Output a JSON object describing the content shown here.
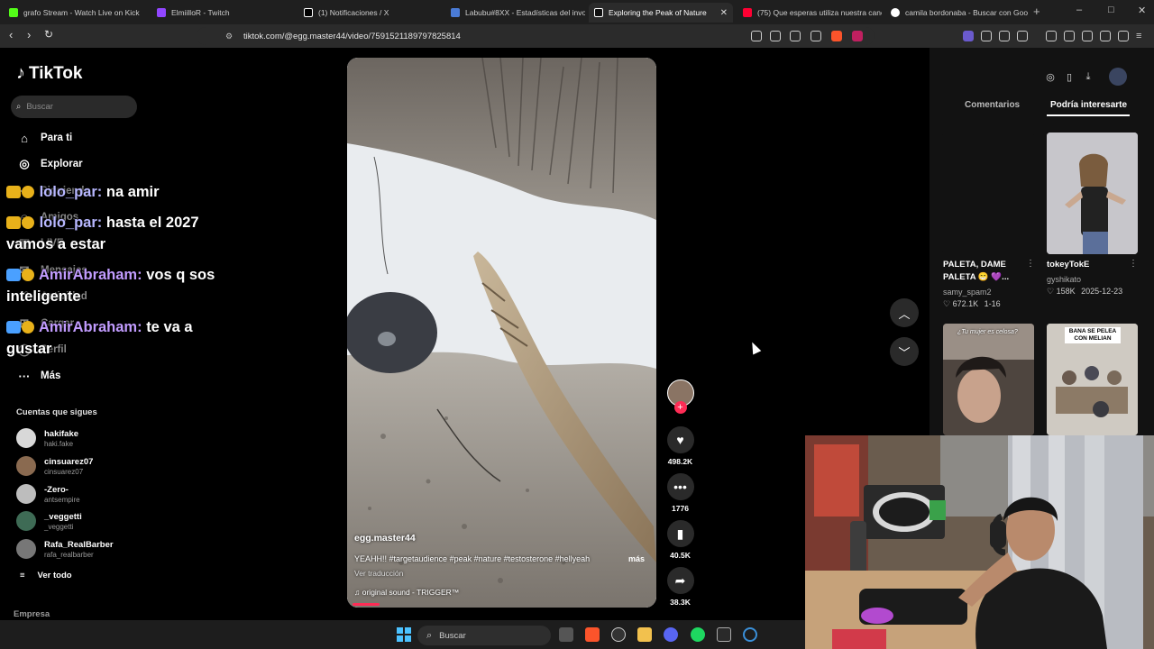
{
  "browser": {
    "tabs": [
      {
        "label": "grafo Stream - Watch Live on Kick",
        "color": "#53fc18"
      },
      {
        "label": "ElmiilloR - Twitch",
        "color": "#9146ff"
      },
      {
        "label": "(1) Notificaciones / X",
        "color": "#ffffff"
      },
      {
        "label": "Labubu#8XX - Estadísticas del invoca",
        "color": "#4a7bd6"
      },
      {
        "label": "Exploring the Peak of Nature",
        "color": "#ffffff"
      },
      {
        "label": "(75) Que esperas utiliza nuestra canc",
        "color": "#ff0033"
      },
      {
        "label": "camila bordonaba - Buscar con Goo",
        "color": "#4285f4"
      }
    ],
    "new_tab": "+",
    "url": "tiktok.com/@egg.master44/video/7591521189797825814",
    "window_controls": [
      "–",
      "□",
      "✕"
    ]
  },
  "tiktok": {
    "logo": "TikTok",
    "search_placeholder": "Buscar",
    "nav": [
      {
        "label": "Para ti",
        "icon": "home-icon"
      },
      {
        "label": "Explorar",
        "icon": "compass-icon"
      },
      {
        "label": "Siguiendo",
        "icon": "following-icon"
      },
      {
        "label": "Amigos",
        "icon": "friends-icon"
      },
      {
        "label": "LIVE",
        "icon": "live-icon"
      },
      {
        "label": "Mensajes",
        "icon": "messages-icon"
      },
      {
        "label": "Actividad",
        "icon": "activity-icon"
      },
      {
        "label": "Cargar",
        "icon": "upload-icon"
      },
      {
        "label": "Perfil",
        "icon": "profile-icon"
      },
      {
        "label": "Más",
        "icon": "more-icon"
      }
    ],
    "following_title": "Cuentas que sigues",
    "following": [
      {
        "name": "hakifake",
        "handle": "haki.fake",
        "color": "#d8d8d8"
      },
      {
        "name": "cinsuarez07",
        "handle": "cinsuarez07",
        "color": "#8a6a50"
      },
      {
        "name": "-Zero-",
        "handle": "antsempire",
        "color": "#bdbdbd"
      },
      {
        "name": "_veggetti",
        "handle": "_veggetti",
        "color": "#3e6b55"
      },
      {
        "name": "Rafa_RealBarber",
        "handle": "rafa_realbarber",
        "color": "#777777"
      }
    ],
    "see_all": "Ver todo",
    "footer": "Empresa",
    "video": {
      "author": "egg.master44",
      "caption": "YEAHH!! #targetaudience #peak #nature #testosterone #hellyeah",
      "more": "más",
      "translation": "Ver traducción",
      "sound": "original sound - TRIGGER™"
    },
    "actions": {
      "likes": "498.2K",
      "comments": "1776",
      "saves": "40.5K",
      "shares": "38.3K"
    },
    "right_panel": {
      "tab_comments": "Comentarios",
      "tab_suggested": "Podría interesarte",
      "items": [
        {
          "title": "PALETA, DAME PALETA 😁 💜...",
          "user": "samy_spam2",
          "likes": "672.1K",
          "date": "1-16"
        },
        {
          "title": "tokeyTokE",
          "user": "gyshikato",
          "likes": "158K",
          "date": "2025-12-23"
        },
        {
          "overlay": "¿Tu mujer es celosa?"
        },
        {
          "overlay": "BANA SE PELEA CON MELIAN"
        }
      ]
    }
  },
  "chat": [
    {
      "user": "lolo_par:",
      "msg": "na amir"
    },
    {
      "user": "lolo_par:",
      "msg": "hasta el 2027 vamos a estar"
    },
    {
      "user": "AmirAbraham:",
      "msg": "vos q sos inteligente"
    },
    {
      "user": "AmirAbraham:",
      "msg": "te va a gustar"
    }
  ],
  "taskbar": {
    "search_placeholder": "Buscar"
  }
}
